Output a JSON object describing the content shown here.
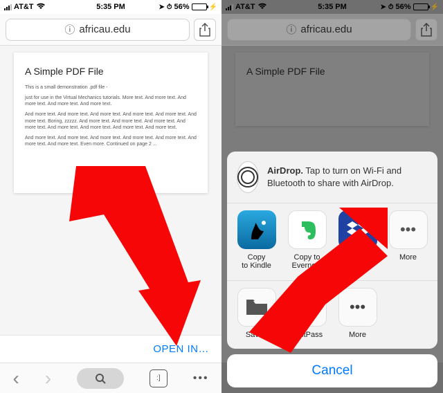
{
  "status": {
    "carrier": "AT&T",
    "time": "5:35 PM",
    "battery_pct": "56%",
    "location_glyph": "➤",
    "alarm_glyph": "⏰",
    "bolt_glyph": "⚡"
  },
  "url": {
    "domain": "africau.edu",
    "lock_glyph": "ⓘ"
  },
  "document": {
    "title": "A Simple PDF File",
    "p1": "This is a small demonstration .pdf file -",
    "p2": "just for use in the Virtual Mechanics tutorials. More text. And more text. And more text. And more text. And more text.",
    "p3": "And more text. And more text. And more text. And more text. And more text. And more text. Boring, zzzzz. And more text. And more text. And more text. And more text. And more text. And more text. And more text. And more text.",
    "p4": "And more text. And more text. And more text. And more text. And more text. And more text. And more text. Even more. Continued on page 2 ..."
  },
  "openin_label": "OPEN IN…",
  "toolbar": {
    "back": "‹",
    "forward": "›",
    "search_glyph": "🔍",
    "tabs_glyph": ":]",
    "more_glyph": "•••"
  },
  "share": {
    "airdrop_title": "AirDrop.",
    "airdrop_body": "Tap to turn on Wi-Fi and Bluetooth to share with AirDrop.",
    "apps": [
      {
        "name": "Copy to Kindle",
        "label": "Copy\nto Kindle"
      },
      {
        "name": "Copy to Evernote",
        "label": "Copy to\nEvernote"
      },
      {
        "name": "Copy to Dropbox",
        "label": "Copy to\nDropbox"
      },
      {
        "name": "More",
        "label": "More"
      }
    ],
    "actions": [
      {
        "name": "Save to Files",
        "label": "Save t"
      },
      {
        "name": "LastPass",
        "label": "LastPass"
      },
      {
        "name": "More",
        "label": "More"
      }
    ],
    "cancel": "Cancel"
  }
}
